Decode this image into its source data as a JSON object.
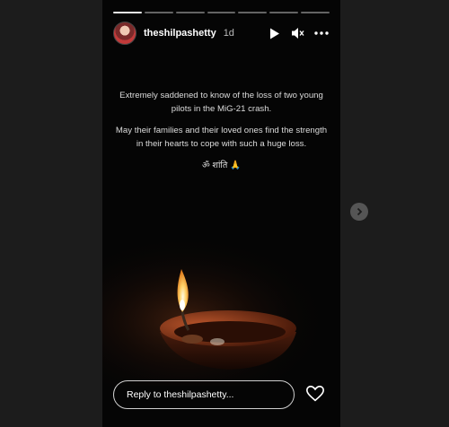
{
  "story": {
    "progress_segments": 7,
    "active_segment": 0,
    "username": "theshilpashetty",
    "age": "1d",
    "caption": {
      "line1": "Extremely saddened to know of the loss of two young pilots in the MiG-21 crash.",
      "line2": "May their families and their loved ones find the strength in their hearts to cope with such a huge loss.",
      "line3": "ॐ शांति 🙏"
    }
  },
  "reply": {
    "placeholder": "Reply to theshilpashetty..."
  },
  "icons": {
    "play": "play-icon",
    "mute": "speaker-muted-icon",
    "more": "more-dots-icon",
    "like": "heart-icon",
    "next": "chevron-right-icon"
  }
}
